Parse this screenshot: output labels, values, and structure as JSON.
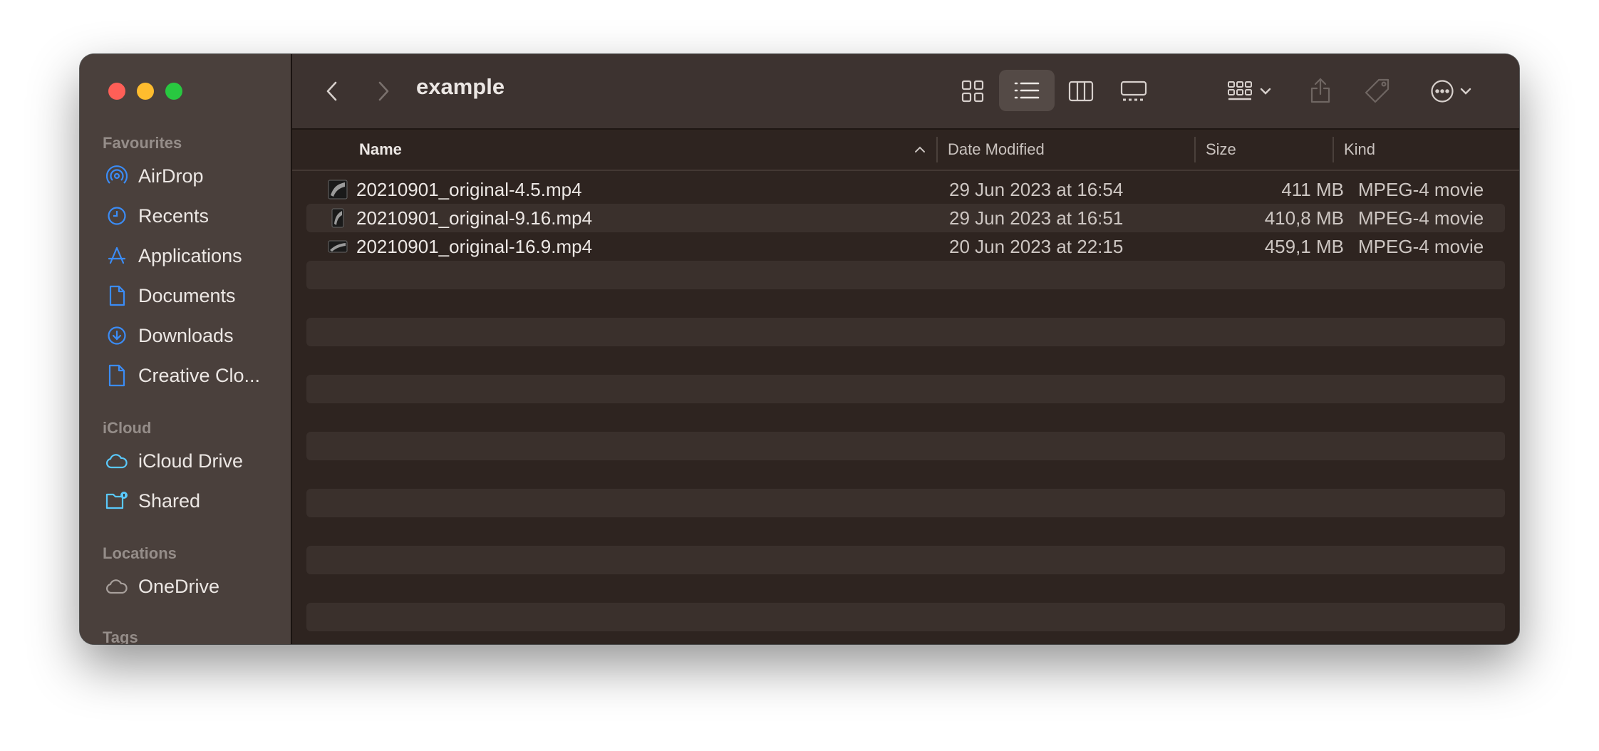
{
  "window": {
    "title": "example"
  },
  "sidebar": {
    "sections": [
      {
        "title": "Favourites",
        "items": [
          {
            "label": "AirDrop",
            "icon": "airdrop-icon"
          },
          {
            "label": "Recents",
            "icon": "clock-icon"
          },
          {
            "label": "Applications",
            "icon": "applications-icon"
          },
          {
            "label": "Documents",
            "icon": "document-icon"
          },
          {
            "label": "Downloads",
            "icon": "download-icon"
          },
          {
            "label": "Creative Clo...",
            "icon": "file-icon"
          }
        ]
      },
      {
        "title": "iCloud",
        "items": [
          {
            "label": "iCloud Drive",
            "icon": "cloud-icon"
          },
          {
            "label": "Shared",
            "icon": "shared-folder-icon"
          }
        ]
      },
      {
        "title": "Locations",
        "items": [
          {
            "label": "OneDrive",
            "icon": "cloud-icon"
          }
        ]
      },
      {
        "title": "Tags",
        "items": []
      }
    ]
  },
  "columns": {
    "name": "Name",
    "date": "Date Modified",
    "size": "Size",
    "kind": "Kind"
  },
  "files": [
    {
      "name": "20210901_original-4.5.mp4",
      "date": "29 Jun 2023 at 16:54",
      "size": "411 MB",
      "kind": "MPEG-4 movie"
    },
    {
      "name": "20210901_original-9.16.mp4",
      "date": "29 Jun 2023 at 16:51",
      "size": "410,8 MB",
      "kind": "MPEG-4 movie"
    },
    {
      "name": "20210901_original-16.9.mp4",
      "date": "20 Jun 2023 at 22:15",
      "size": "459,1 MB",
      "kind": "MPEG-4 movie"
    }
  ],
  "colors": {
    "accent": "#3b8cf6",
    "icloud": "#5ac8fa"
  }
}
